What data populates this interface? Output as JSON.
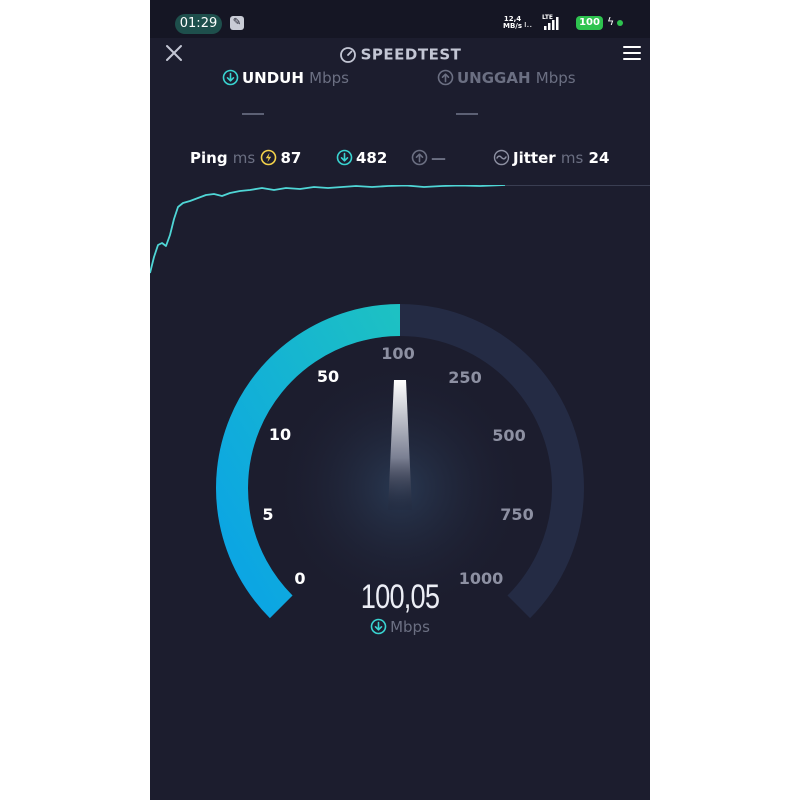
{
  "status_bar": {
    "time": "01:29",
    "net_speed_value": "12,4",
    "net_speed_unit": "MB/s",
    "network_type": "LTE",
    "battery": "100"
  },
  "header": {
    "title": "SPEEDTEST"
  },
  "tabs": {
    "download_label": "UNDUH",
    "download_unit": "Mbps",
    "upload_label": "UNGGAH",
    "upload_unit": "Mbps",
    "download_value": "—",
    "upload_value": "—"
  },
  "metrics": {
    "ping_label": "Ping",
    "ping_unit": "ms",
    "ping_value": "87",
    "download_ping": "482",
    "upload_ping": "—",
    "jitter_label": "Jitter",
    "jitter_unit": "ms",
    "jitter_value": "24"
  },
  "gauge": {
    "ticks": [
      "0",
      "5",
      "10",
      "50",
      "100",
      "250",
      "500",
      "750",
      "1000"
    ],
    "current_value": "100,05",
    "unit": "Mbps",
    "fill_fraction": 0.5,
    "colors": {
      "fill_start": "#0aa3e6",
      "fill_end": "#1dc1c3",
      "track": "#242b44",
      "accent": "#39d3d0"
    }
  }
}
